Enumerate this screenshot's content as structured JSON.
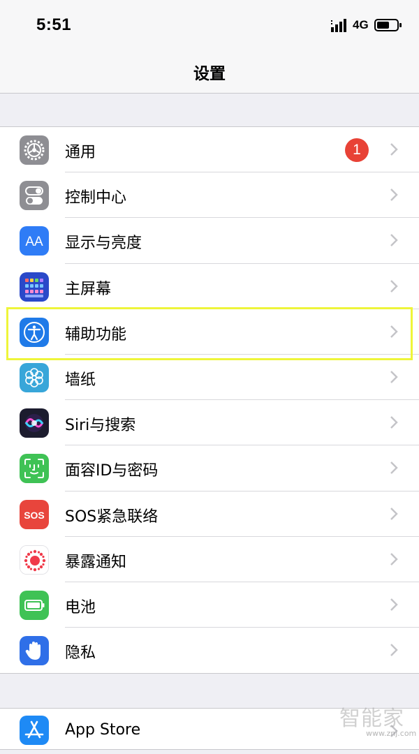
{
  "status_bar": {
    "time": "5:51",
    "network": "4G",
    "signal_icon": "signal-bars-icon",
    "battery_icon": "battery-icon"
  },
  "nav": {
    "title": "设置"
  },
  "settings_group_1": [
    {
      "label": "通用",
      "icon": "gear-icon",
      "color": "#8e8e93",
      "badge": "1"
    },
    {
      "label": "控制中心",
      "icon": "toggle-switches-icon",
      "color": "#8e8e93"
    },
    {
      "label": "显示与亮度",
      "icon": "aa-text-icon",
      "color": "#2f7cf6",
      "icon_text": "AA"
    },
    {
      "label": "主屏幕",
      "icon": "app-grid-icon",
      "color": "#2a49c9"
    },
    {
      "label": "辅助功能",
      "icon": "accessibility-person-icon",
      "color": "#1f7ae8"
    },
    {
      "label": "墙纸",
      "icon": "flower-icon",
      "color": "#38a6d9"
    },
    {
      "label": "Siri与搜索",
      "icon": "siri-orb-icon",
      "color": "#1c1c2e"
    },
    {
      "label": "面容ID与密码",
      "icon": "face-id-icon",
      "color": "#3fc255"
    },
    {
      "label": "SOS紧急联络",
      "icon": "sos-icon",
      "color": "#e8453c",
      "icon_text": "SOS"
    },
    {
      "label": "暴露通知",
      "icon": "exposure-dots-icon",
      "color": "#ffffff"
    },
    {
      "label": "电池",
      "icon": "battery-icon",
      "color": "#3fc255"
    },
    {
      "label": "隐私",
      "icon": "hand-icon",
      "color": "#2f6fe8"
    }
  ],
  "settings_group_2": [
    {
      "label": "App Store",
      "icon": "app-store-icon",
      "color": "#1e8af5"
    }
  ],
  "highlight": {
    "row": "辅助功能",
    "color": "#eef53a"
  },
  "watermark": {
    "text": "智能家",
    "url": "www.znj.com"
  }
}
